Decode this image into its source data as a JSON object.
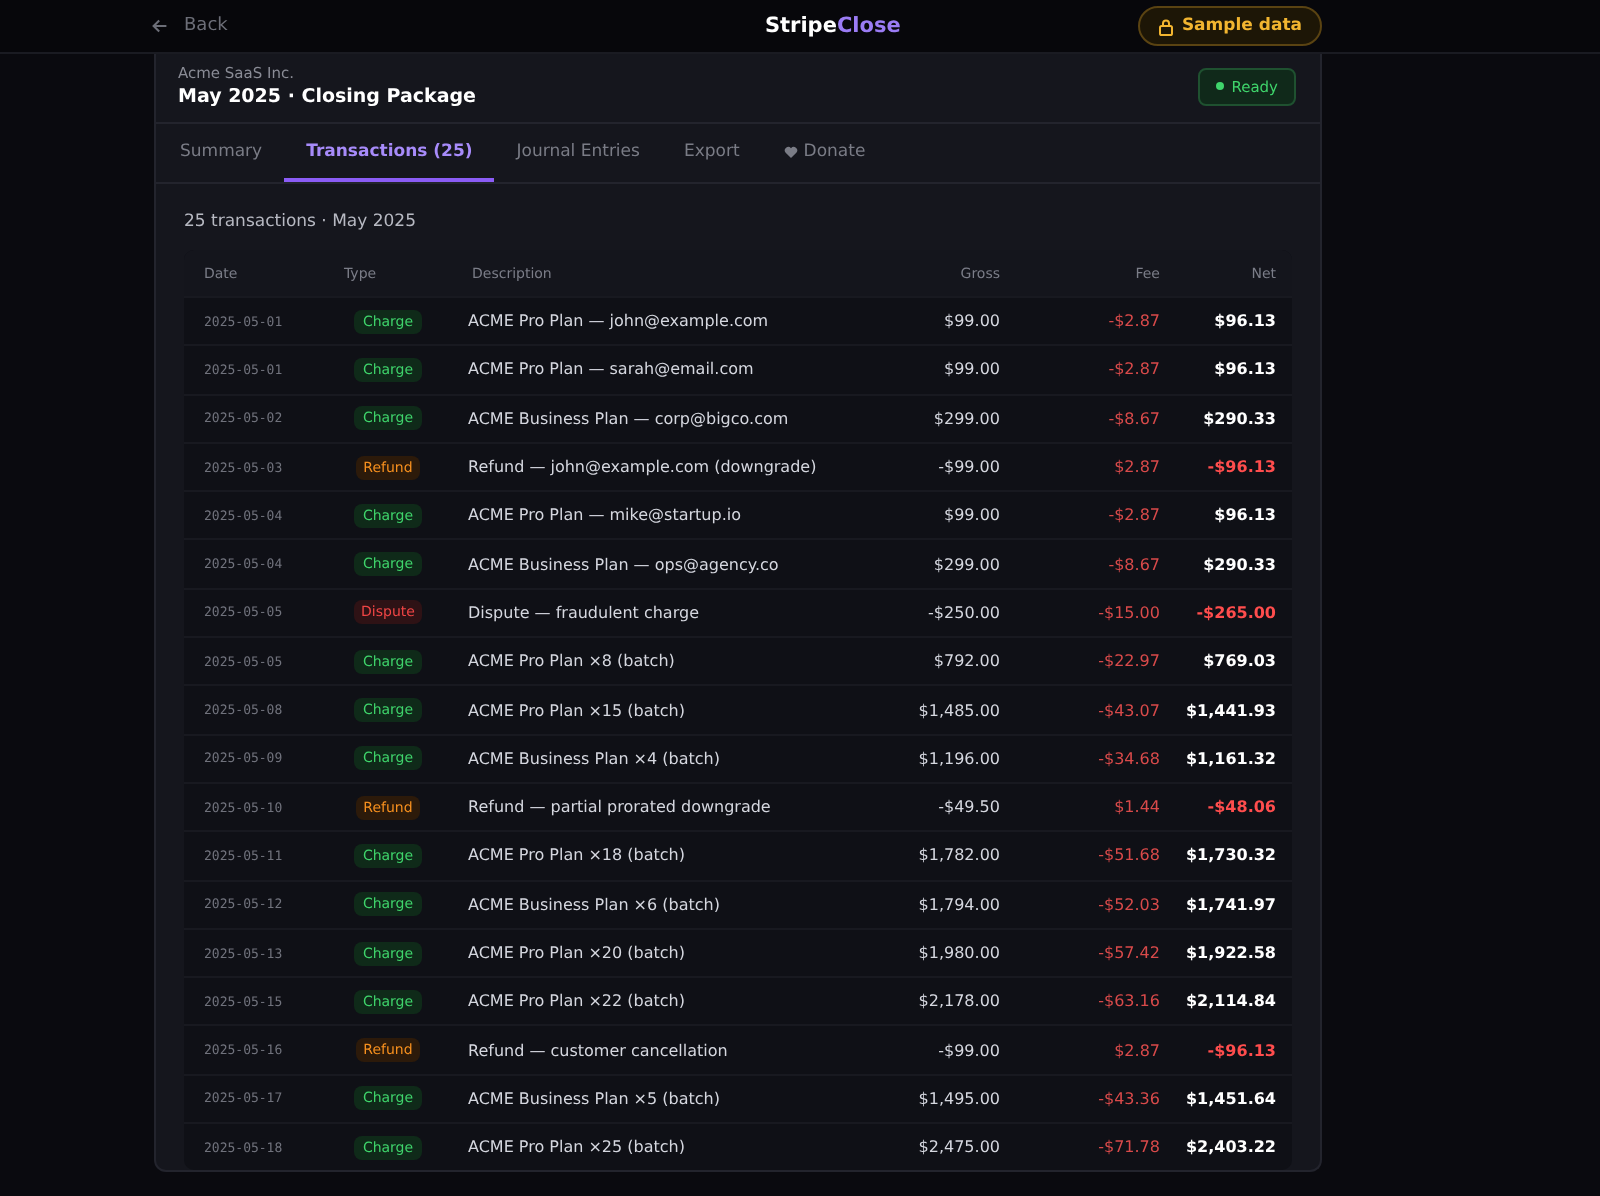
{
  "topbar": {
    "back": "Back",
    "logo": {
      "first": "Stripe",
      "second": "Close"
    },
    "sample_badge": "Sample data"
  },
  "header": {
    "company": "Acme SaaS Inc.",
    "title": "May 2025 · Closing Package",
    "status": "Ready"
  },
  "tabs": [
    {
      "label": "Summary",
      "selected": false,
      "kind": "plain"
    },
    {
      "label": "Transactions (25)",
      "selected": true,
      "kind": "plain"
    },
    {
      "label": "Journal Entries",
      "selected": false,
      "kind": "plain"
    },
    {
      "label": "Export",
      "selected": false,
      "kind": "plain"
    },
    {
      "label": "Donate",
      "selected": false,
      "kind": "donate"
    }
  ],
  "summary": "25 transactions · May 2025",
  "table": {
    "columns": [
      "Date",
      "Type",
      "Description",
      "Gross",
      "Fee",
      "Net"
    ],
    "rows": [
      {
        "date": "2025-05-01",
        "kind": "charge",
        "type": "Charge",
        "description": "ACME Pro Plan — john@example.com",
        "gross": "$99.00",
        "fee": "-$2.87",
        "net": "$96.13"
      },
      {
        "date": "2025-05-01",
        "kind": "charge",
        "type": "Charge",
        "description": "ACME Pro Plan — sarah@email.com",
        "gross": "$99.00",
        "fee": "-$2.87",
        "net": "$96.13"
      },
      {
        "date": "2025-05-02",
        "kind": "charge",
        "type": "Charge",
        "description": "ACME Business Plan — corp@bigco.com",
        "gross": "$299.00",
        "fee": "-$8.67",
        "net": "$290.33"
      },
      {
        "date": "2025-05-03",
        "kind": "refund",
        "type": "Refund",
        "description": "Refund — john@example.com (downgrade)",
        "gross": "-$99.00",
        "fee": "$2.87",
        "net": "-$96.13"
      },
      {
        "date": "2025-05-04",
        "kind": "charge",
        "type": "Charge",
        "description": "ACME Pro Plan — mike@startup.io",
        "gross": "$99.00",
        "fee": "-$2.87",
        "net": "$96.13"
      },
      {
        "date": "2025-05-04",
        "kind": "charge",
        "type": "Charge",
        "description": "ACME Business Plan — ops@agency.co",
        "gross": "$299.00",
        "fee": "-$8.67",
        "net": "$290.33"
      },
      {
        "date": "2025-05-05",
        "kind": "dispute",
        "type": "Dispute",
        "description": "Dispute — fraudulent charge",
        "gross": "-$250.00",
        "fee": "-$15.00",
        "net": "-$265.00"
      },
      {
        "date": "2025-05-05",
        "kind": "charge",
        "type": "Charge",
        "description": "ACME Pro Plan ×8 (batch)",
        "gross": "$792.00",
        "fee": "-$22.97",
        "net": "$769.03"
      },
      {
        "date": "2025-05-08",
        "kind": "charge",
        "type": "Charge",
        "description": "ACME Pro Plan ×15 (batch)",
        "gross": "$1,485.00",
        "fee": "-$43.07",
        "net": "$1,441.93"
      },
      {
        "date": "2025-05-09",
        "kind": "charge",
        "type": "Charge",
        "description": "ACME Business Plan ×4 (batch)",
        "gross": "$1,196.00",
        "fee": "-$34.68",
        "net": "$1,161.32"
      },
      {
        "date": "2025-05-10",
        "kind": "refund",
        "type": "Refund",
        "description": "Refund — partial prorated downgrade",
        "gross": "-$49.50",
        "fee": "$1.44",
        "net": "-$48.06"
      },
      {
        "date": "2025-05-11",
        "kind": "charge",
        "type": "Charge",
        "description": "ACME Pro Plan ×18 (batch)",
        "gross": "$1,782.00",
        "fee": "-$51.68",
        "net": "$1,730.32"
      },
      {
        "date": "2025-05-12",
        "kind": "charge",
        "type": "Charge",
        "description": "ACME Business Plan ×6 (batch)",
        "gross": "$1,794.00",
        "fee": "-$52.03",
        "net": "$1,741.97"
      },
      {
        "date": "2025-05-13",
        "kind": "charge",
        "type": "Charge",
        "description": "ACME Pro Plan ×20 (batch)",
        "gross": "$1,980.00",
        "fee": "-$57.42",
        "net": "$1,922.58"
      },
      {
        "date": "2025-05-15",
        "kind": "charge",
        "type": "Charge",
        "description": "ACME Pro Plan ×22 (batch)",
        "gross": "$2,178.00",
        "fee": "-$63.16",
        "net": "$2,114.84"
      },
      {
        "date": "2025-05-16",
        "kind": "refund",
        "type": "Refund",
        "description": "Refund — customer cancellation",
        "gross": "-$99.00",
        "fee": "$2.87",
        "net": "-$96.13"
      },
      {
        "date": "2025-05-17",
        "kind": "charge",
        "type": "Charge",
        "description": "ACME Business Plan ×5 (batch)",
        "gross": "$1,495.00",
        "fee": "-$43.36",
        "net": "$1,451.64"
      },
      {
        "date": "2025-05-18",
        "kind": "charge",
        "type": "Charge",
        "description": "ACME Pro Plan ×25 (batch)",
        "gross": "$2,475.00",
        "fee": "-$71.78",
        "net": "$2,403.22"
      }
    ]
  }
}
